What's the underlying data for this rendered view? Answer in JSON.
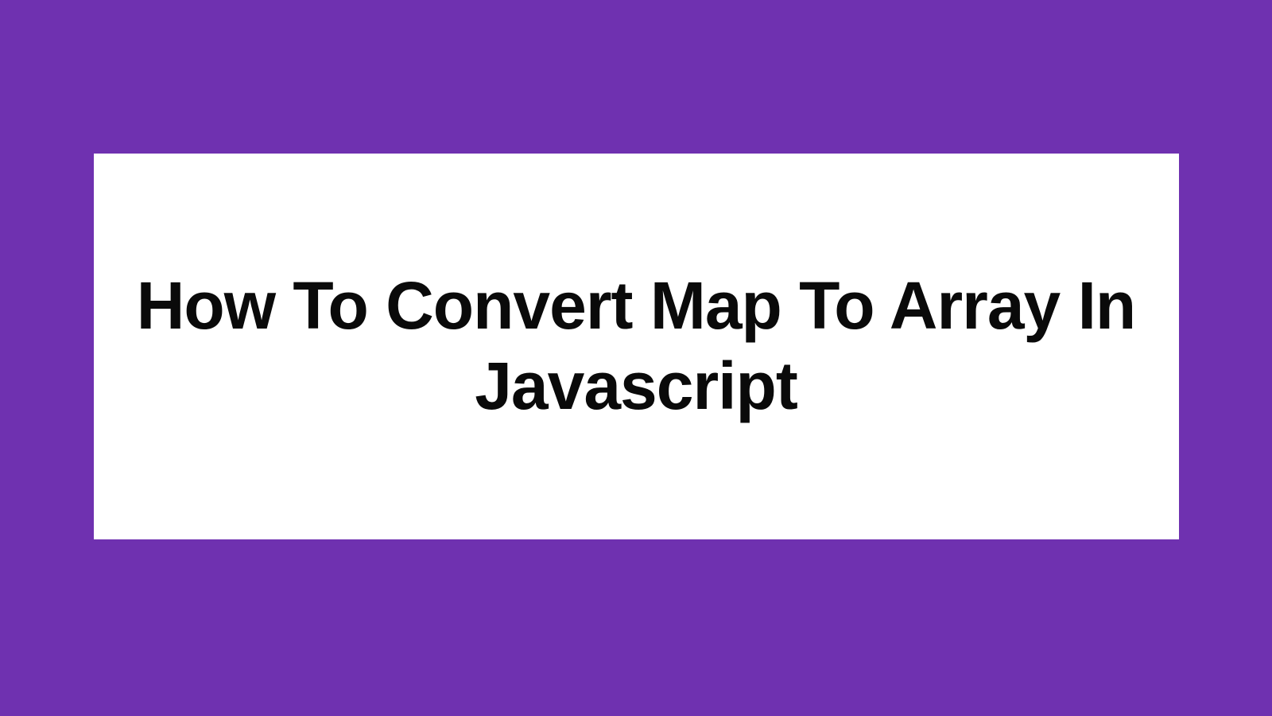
{
  "card": {
    "title": "How To Convert Map To Array In Javascript"
  },
  "colors": {
    "background": "#6f31b0",
    "card_background": "#ffffff",
    "text": "#0a0a0a"
  }
}
